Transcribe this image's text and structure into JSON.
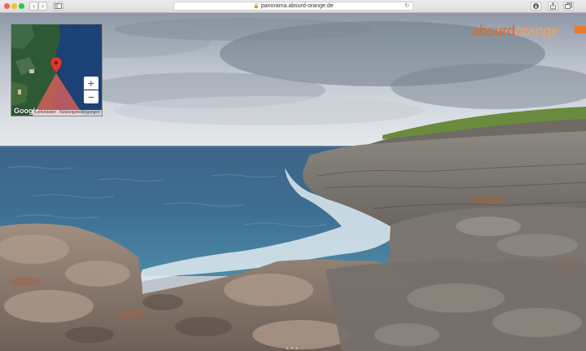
{
  "browser": {
    "url": "panorama.absurd-orange.de",
    "back_glyph": "‹",
    "forward_glyph": "›",
    "reload_glyph": "↻",
    "lock_glyph": "🔒",
    "icons": [
      "back-icon",
      "forward-icon",
      "sidebar-icon",
      "lock-icon",
      "reload-icon",
      "download-icon",
      "share-icon",
      "tabs-icon"
    ]
  },
  "brand": {
    "part1": "absurd",
    "part2": "orange",
    "color_primary": "#e06a1f",
    "color_secondary": "#f0a15f"
  },
  "minimap": {
    "zoom_in_label": "+",
    "zoom_out_label": "−",
    "logo_text": "Google",
    "map_data_label": "Kartendaten",
    "terms_label": "Nutzungsbedingungen",
    "view_cone_color": "#e8605a",
    "pin_color": "#d93b30"
  },
  "viewer": {
    "pager_dots": "• • •"
  }
}
